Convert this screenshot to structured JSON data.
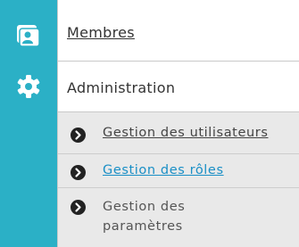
{
  "sidebar": {
    "icons": [
      "contacts-card-icon",
      "gear-icon"
    ],
    "accent_color": "#2bb0c6"
  },
  "menu": {
    "membres_label": "Membres",
    "administration_label": "Administration",
    "submenu": [
      {
        "label": "Gestion des utilisateurs",
        "active": false
      },
      {
        "label": "Gestion des rôles",
        "active": true
      },
      {
        "label": "Gestion des paramètres",
        "active": false
      }
    ],
    "active_link_color": "#1a8fc6"
  }
}
